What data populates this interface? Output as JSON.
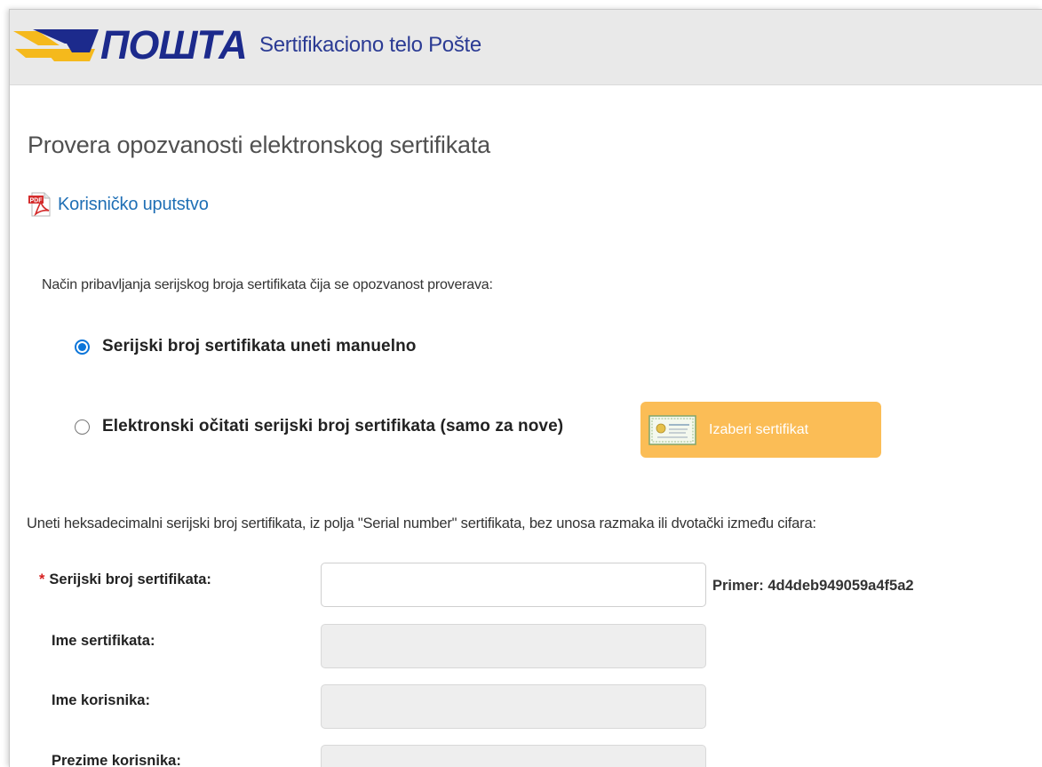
{
  "header": {
    "logo_text": "ПОШТА",
    "site_title": "Sertifikaciono telo Pošte",
    "colors": {
      "background": "#e9e9e9",
      "logo_blue": "#1c2a8c",
      "logo_yellow": "#f5b91c"
    }
  },
  "page": {
    "title": "Provera opozvanosti elektronskog sertifikata",
    "manual_link": {
      "icon": "pdf-icon",
      "label": "Korisničko uputstvo"
    },
    "intro": "Način pribavljanja serijskog broja sertifikata čija se opozvanost proverava:"
  },
  "options": {
    "manual": {
      "label": "Serijski broj sertifikata uneti manuelno",
      "checked": true
    },
    "electronic": {
      "label": "Elektronski očitati serijski broj sertifikata (samo za nove)",
      "checked": false
    }
  },
  "choose_button": {
    "icon": "certificate-icon",
    "label": "Izaberi sertifikat",
    "color": "#fbbd56"
  },
  "hint": "Uneti heksadecimalni serijski broj sertifikata, iz polja \"Serial number\" sertifikata, bez unosa razmaka ili dvotački između cifara:",
  "form": {
    "serial": {
      "required_mark": "*",
      "label": "Serijski broj sertifikata:",
      "value": "",
      "example": "Primer: 4d4deb949059a4f5a2"
    },
    "cert_name": {
      "label": "Ime sertifikata:",
      "value": ""
    },
    "first_name": {
      "label": "Ime korisnika:",
      "value": ""
    },
    "last_name": {
      "label": "Prezime korisnika:",
      "value": ""
    }
  },
  "accent_color": "#0b75d9"
}
